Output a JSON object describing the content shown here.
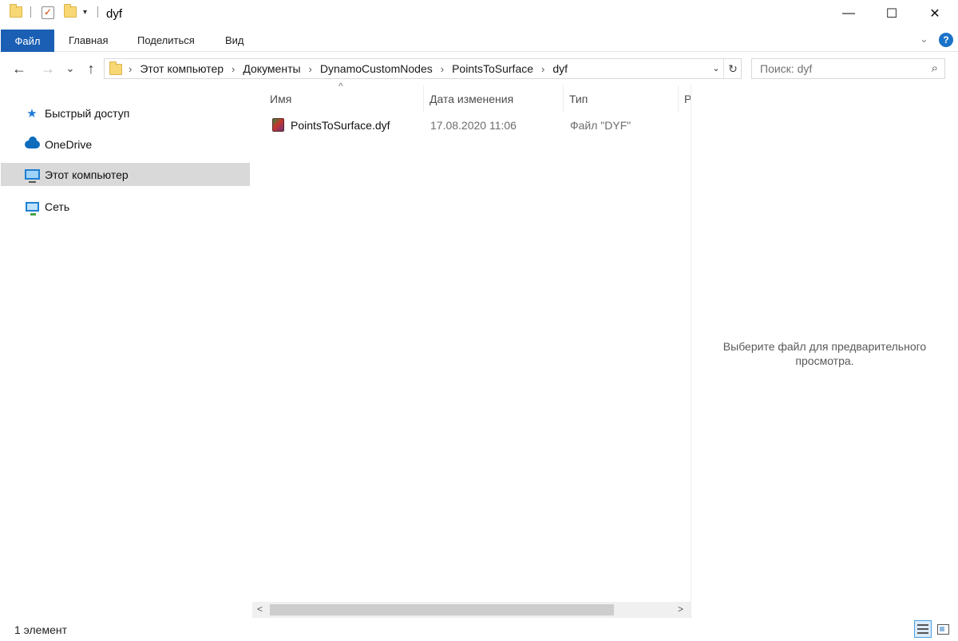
{
  "window": {
    "title": "dyf",
    "quick_access_icons": [
      "folder-icon",
      "properties-check-icon",
      "new-folder-icon",
      "customize-dropdown-icon"
    ],
    "controls": {
      "minimize": "—",
      "maximize": "☐",
      "close": "✕"
    }
  },
  "ribbon": {
    "file_tab": "Файл",
    "tabs": [
      "Главная",
      "Поделиться",
      "Вид"
    ],
    "collapse_icon": "chevron-down-icon",
    "help_icon": "?"
  },
  "nav": {
    "back": "←",
    "forward": "→",
    "recent": "⌄",
    "up": "↑",
    "breadcrumbs": [
      "Этот компьютер",
      "Документы",
      "DynamoCustomNodes",
      "PointsToSurface",
      "dyf"
    ],
    "separator": "›",
    "address_dropdown": "⌄",
    "refresh": "↻",
    "search_placeholder": "Поиск: dyf",
    "search_icon": "⌕"
  },
  "sidebar": {
    "items": [
      {
        "label": "Быстрый доступ",
        "icon": "star-icon",
        "selected": false
      },
      {
        "label": "OneDrive",
        "icon": "cloud-icon",
        "selected": false
      },
      {
        "label": "Этот компьютер",
        "icon": "computer-icon",
        "selected": true
      },
      {
        "label": "Сеть",
        "icon": "network-icon",
        "selected": false
      }
    ]
  },
  "file_list": {
    "columns": [
      "Имя",
      "Дата изменения",
      "Тип",
      "Р"
    ],
    "sort_indicator": "^",
    "rows": [
      {
        "name": "PointsToSurface.dyf",
        "modified": "17.08.2020 11:06",
        "type": "Файл \"DYF\"",
        "icon": "dyf-file-icon"
      }
    ],
    "scroll_left": "<",
    "scroll_right": ">"
  },
  "preview": {
    "message_line1": "Выберите файл для предварительного",
    "message_line2": "просмотра."
  },
  "status": {
    "item_count": "1 элемент",
    "view_modes": [
      "details-view-icon",
      "large-icons-view-icon"
    ]
  },
  "colors": {
    "file_tab": "#1a5fb4",
    "selected_nav": "#d9d9d9",
    "help": "#1a73c9"
  }
}
